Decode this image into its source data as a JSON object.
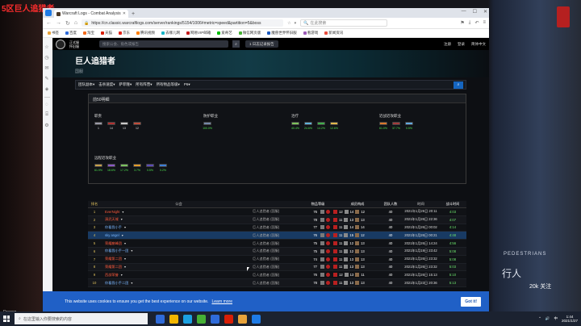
{
  "desktop": {
    "left_label": "5区巨人追猎者",
    "bottom_label": "Dragon",
    "right_text": "PEDESTRIANS",
    "right_text2": "行人",
    "badge": "20k 关注"
  },
  "browser": {
    "tab_title": "Warcraft Logs - Combat Analysis",
    "new_tab": "+",
    "url": "https://cn.classic.warcraftlogs.com/server/rankings/5154/1006#metric=speed&partition=5&boss",
    "search_placeholder": "在此搜索",
    "bookmarks": [
      {
        "label": "书签",
        "color": "#e8a33b"
      },
      {
        "label": "百度",
        "color": "#2f6bd9"
      },
      {
        "label": "淘宝",
        "color": "#f26a1b"
      },
      {
        "label": "天猫",
        "color": "#d81e06"
      },
      {
        "label": "京东",
        "color": "#e1251b"
      },
      {
        "label": "腾讯视频",
        "color": "#ff7f00"
      },
      {
        "label": "去哪儿网",
        "color": "#18b4c6"
      },
      {
        "label": "网易VIP邮箱",
        "color": "#c31d1d"
      },
      {
        "label": "爱奇艺",
        "color": "#00be06"
      },
      {
        "label": "微信网页版",
        "color": "#46b035"
      },
      {
        "label": "魔兽世界怀旧服",
        "color": "#1d5bbf"
      },
      {
        "label": "看游戏",
        "color": "#9b59b6"
      },
      {
        "label": "新闻资讯",
        "color": "#e74c3c"
      }
    ]
  },
  "site": {
    "brand_line1": "正式服",
    "brand_line2": "怀旧服",
    "search_placeholder": "搜索公会、角色或报告",
    "upload_label": "1 日志记录报告",
    "register": "注册",
    "login": "登录",
    "language": "简体中文",
    "server_title": "巨人追猎者",
    "server_region": "国服"
  },
  "filters": [
    "团队副本▾",
    "击杀速度▾",
    "萨菲隆▾",
    "所有阵营▾",
    "所有物品等级▾",
    "P6▾"
  ],
  "top_panel": {
    "header": "前50明细",
    "groups": [
      {
        "title": "职责",
        "icons": [
          {
            "color": "#9a9aa8",
            "value": "1"
          },
          {
            "color": "#b23030",
            "value": "14"
          },
          {
            "color": "#c9c9c9",
            "value": "13"
          },
          {
            "color": "#c04c3a",
            "value": "12"
          }
        ]
      },
      {
        "title": "防护职业",
        "icons": [
          {
            "color": "#7488a8",
            "value": "100.0%"
          }
        ]
      },
      {
        "title": "治疗",
        "icons": [
          {
            "color": "#7cc35b",
            "value": "40.4%"
          },
          {
            "color": "#5fb2d9",
            "value": "24.6%"
          },
          {
            "color": "#3fae4a",
            "value": "14.2%"
          },
          {
            "color": "#e0b84a",
            "value": "12.6%"
          }
        ]
      },
      {
        "title": "近战近攻职业",
        "icons": [
          {
            "color": "#d9782b",
            "value": "61.0%"
          },
          {
            "color": "#a33b3b",
            "value": "37.7%"
          },
          {
            "color": "#62a9e0",
            "value": "0.5%"
          }
        ]
      },
      {
        "title": "远程近攻职业",
        "icons": [
          {
            "color": "#c8a04a",
            "value": "61.9%"
          },
          {
            "color": "#8a58c8",
            "value": "18.6%"
          },
          {
            "color": "#7ac25e",
            "value": "17.2%"
          },
          {
            "color": "#e29b2a",
            "value": "3.7%"
          },
          {
            "color": "#5b4ab8",
            "value": "0.5%"
          },
          {
            "color": "#3d7ed6",
            "value": "0.2%"
          }
        ]
      }
    ]
  },
  "table": {
    "headers": {
      "rank": "排名",
      "guild": "公会",
      "server": "",
      "ilvl": "物品等级",
      "comp": "成员构成",
      "raid_size": "团队人数",
      "date": "时间",
      "speed": "战斗时间"
    },
    "rows": [
      {
        "rank": "1",
        "guild": "EverNight",
        "gcolor": "red",
        "server": "巨人追猎者 (国服)",
        "ilvl": "76",
        "a": "12",
        "b": "14",
        "c": "12",
        "size": "40",
        "date": "2021年1月26日 20:11",
        "speed": "4:03"
      },
      {
        "rank": "2",
        "guild": "演武天域",
        "gcolor": "red",
        "server": "巨人追猎者 (国服)",
        "ilvl": "78",
        "a": "11",
        "b": "13",
        "c": "13",
        "size": "40",
        "date": "2021年1月26日 22:36",
        "speed": "4:07"
      },
      {
        "rank": "3",
        "guild": "你看我小手",
        "gcolor": "blue",
        "server": "巨人追猎者 (国服)",
        "ilvl": "77",
        "a": "11",
        "b": "14",
        "c": "14",
        "size": "40",
        "date": "2021年1月26日 00:02",
        "speed": "4:14"
      },
      {
        "rank": "4",
        "guild": "sky angel",
        "gcolor": "blue",
        "server": "巨人追猎者 (国服)",
        "ilvl": "76",
        "a": "11",
        "b": "15",
        "c": "12",
        "size": "40",
        "date": "2021年1月26日 00:21",
        "speed": "4:48"
      },
      {
        "rank": "5",
        "guild": "荣耀巅峰团",
        "gcolor": "red",
        "server": "巨人追猎者 (国服)",
        "ilvl": "75",
        "a": "11",
        "b": "12",
        "c": "13",
        "size": "40",
        "date": "2021年1月26日 14:24",
        "speed": "4:56"
      },
      {
        "rank": "6",
        "guild": "你看我小手一团",
        "gcolor": "blue",
        "server": "巨人追猎者 (国服)",
        "ilvl": "75",
        "a": "11",
        "b": "12",
        "c": "13",
        "size": "40",
        "date": "2021年1月19日 23:42",
        "speed": "5:08"
      },
      {
        "rank": "7",
        "guild": "荣耀第二团",
        "gcolor": "red",
        "server": "巨人追猎者 (国服)",
        "ilvl": "74",
        "a": "11",
        "b": "13",
        "c": "13",
        "size": "40",
        "date": "2021年1月26日 23:32",
        "speed": "5:08"
      },
      {
        "rank": "8",
        "guild": "荣耀第二团",
        "gcolor": "red",
        "server": "巨人追猎者 (国服)",
        "ilvl": "77",
        "a": "11",
        "b": "13",
        "c": "13",
        "size": "40",
        "date": "2021年1月26日 23:32",
        "speed": "5:03"
      },
      {
        "rank": "9",
        "guild": "西部荣誉",
        "gcolor": "red",
        "server": "巨人追猎者 (国服)",
        "ilvl": "76",
        "a": "12",
        "b": "13",
        "c": "11",
        "size": "40",
        "date": "2021年1月26日 15:13",
        "speed": "5:10"
      },
      {
        "rank": "10",
        "guild": "你看我小手二团",
        "gcolor": "blue",
        "server": "巨人追猎者 (国服)",
        "ilvl": "78",
        "a": "11",
        "b": "13",
        "c": "13",
        "size": "40",
        "date": "2021年1月23日 20:36",
        "speed": "5:13"
      }
    ]
  },
  "cookie": {
    "text": "This website uses cookies to ensure you get the best experience on our website.",
    "learn_more": "Learn more",
    "button": "Got it!"
  },
  "taskbar": {
    "search_placeholder": "在这里输入你要搜索的内容",
    "apps": [
      "#2f6bd9",
      "#f2b600",
      "#1ba1e2",
      "#46b035",
      "#2f6bd9",
      "#d81e06",
      "#e8a33b",
      "#1e7be6"
    ],
    "time": "1:44",
    "date": "2021/1/27",
    "lang": "中"
  }
}
